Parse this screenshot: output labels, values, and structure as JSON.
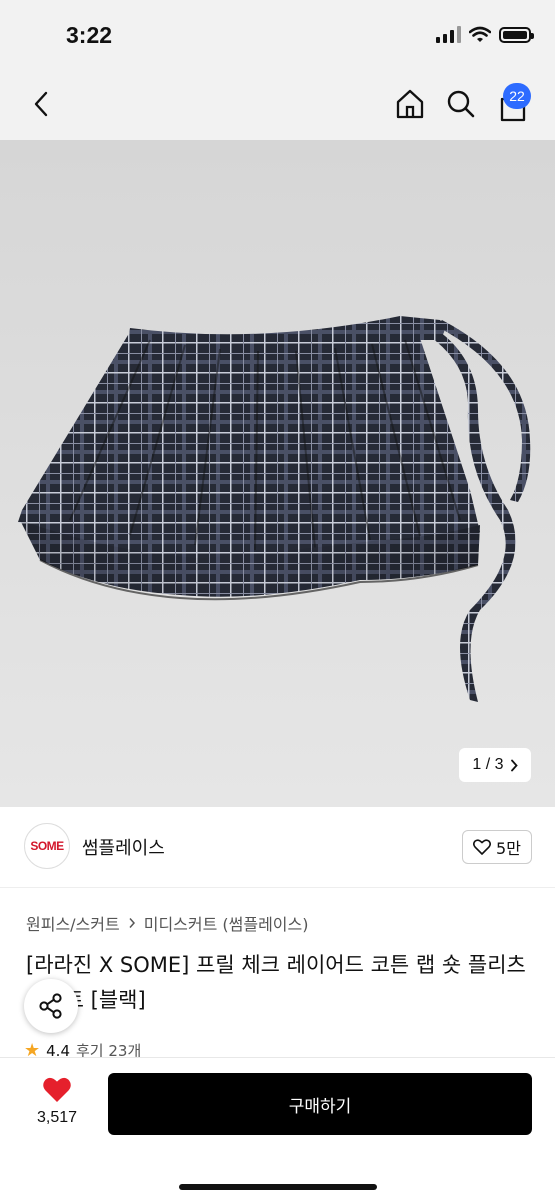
{
  "status_bar": {
    "time": "3:22"
  },
  "nav": {
    "cart_count": "22"
  },
  "gallery": {
    "pager": "1 / 3"
  },
  "brand": {
    "logo_text": "SOME",
    "name": "썸플레이스",
    "likes": "5만"
  },
  "breadcrumb": {
    "level1": "원피스/스커트",
    "level2": "미디스커트 (썸플레이스)"
  },
  "product": {
    "title": "[라라진 X SOME] 프릴 체크 레이어드 코튼 랩 숏 플리츠 스커트 [블랙]"
  },
  "rating": {
    "score": "4.4",
    "reviews": "후기 23개"
  },
  "bottom_bar": {
    "fav_count": "3,517",
    "buy_label": "구매하기"
  },
  "colors": {
    "accent_badge": "#2d6bff",
    "heart": "#e5202c",
    "buy_button": "#000000"
  }
}
